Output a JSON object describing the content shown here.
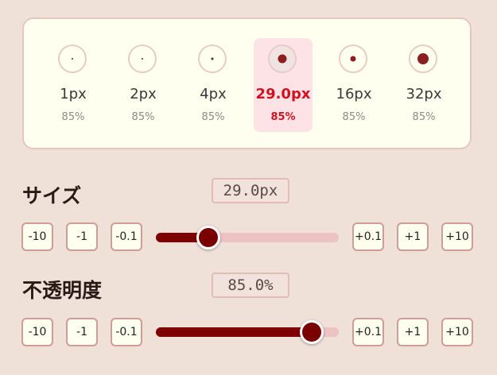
{
  "presets": [
    {
      "size": "1px",
      "opacity": "85%"
    },
    {
      "size": "2px",
      "opacity": "85%"
    },
    {
      "size": "4px",
      "opacity": "85%"
    },
    {
      "size": "29.0px",
      "opacity": "85%",
      "active": true
    },
    {
      "size": "16px",
      "opacity": "85%"
    },
    {
      "size": "32px",
      "opacity": "85%"
    }
  ],
  "size_control": {
    "label": "サイズ",
    "value": "29.0px",
    "level_percent": 28.6,
    "buttons": {
      "m10": "-10",
      "m1": "-1",
      "m01": "-0.1",
      "p01": "+0.1",
      "p1": "+1",
      "p10": "+10"
    }
  },
  "opacity_control": {
    "label": "不透明度",
    "value": "85.0%",
    "level_percent": 85,
    "buttons": {
      "m10": "-10",
      "m1": "-1",
      "m01": "-0.1",
      "p01": "+0.1",
      "p1": "+1",
      "p10": "+10"
    }
  },
  "colors": {
    "accent": "#7f0000",
    "active_text": "#d31020",
    "panel_bg": "#fffff0",
    "page_bg": "#efe0d8"
  }
}
